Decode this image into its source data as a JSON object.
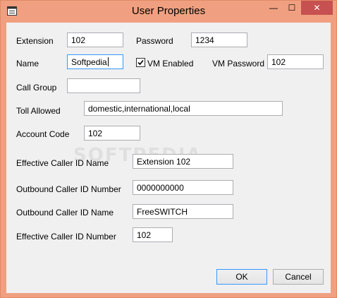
{
  "window": {
    "title": "User Properties"
  },
  "titlebar": {
    "min_glyph": "—",
    "max_glyph": "☐",
    "close_glyph": "✕"
  },
  "form": {
    "extension": {
      "label": "Extension",
      "value": "102"
    },
    "password": {
      "label": "Password",
      "value": "1234"
    },
    "name": {
      "label": "Name",
      "value": "Softpedia"
    },
    "vm_enabled": {
      "label": "VM Enabled",
      "checked": true
    },
    "vm_password": {
      "label": "VM Password",
      "value": "102"
    },
    "call_group": {
      "label": "Call Group",
      "value": ""
    },
    "toll_allowed": {
      "label": "Toll Allowed",
      "value": "domestic,international,local"
    },
    "account_code": {
      "label": "Account Code",
      "value": "102"
    },
    "effective_cid_name": {
      "label": "Effective Caller ID Name",
      "value": "Extension 102"
    },
    "outbound_cid_number": {
      "label": "Outbound Caller ID Number",
      "value": "0000000000"
    },
    "outbound_cid_name": {
      "label": "Outbound Caller ID Name",
      "value": "FreeSWITCH"
    },
    "effective_cid_number": {
      "label": "Effective Caller ID Number",
      "value": "102"
    }
  },
  "buttons": {
    "ok": "OK",
    "cancel": "Cancel"
  },
  "watermark": "SOFTPEDIA"
}
